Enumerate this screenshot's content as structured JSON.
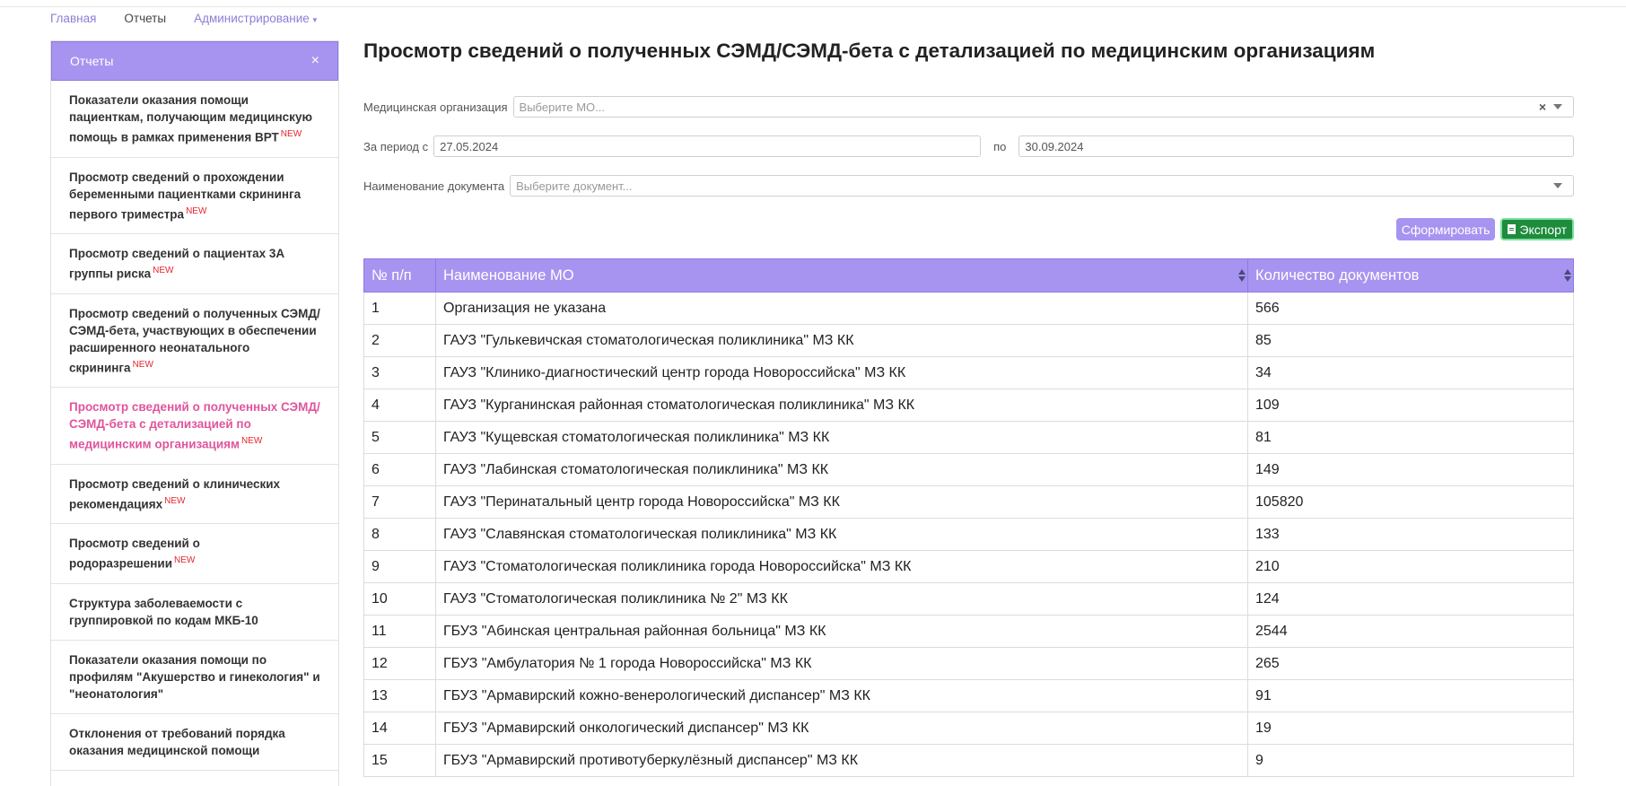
{
  "topnav": {
    "home": "Главная",
    "reports": "Отчеты",
    "admin": "Администрирование",
    "admin_caret": "▾"
  },
  "sidebar": {
    "title": "Отчеты",
    "close": "×",
    "new_badge": "NEW",
    "items": [
      {
        "label": "Показатели оказания помощи пациенткам, получающим медицинскую помощь в рамках применения ВРТ",
        "new": true
      },
      {
        "label": "Просмотр сведений о прохождении беременными пациентками скрининга первого триместра",
        "new": true
      },
      {
        "label": "Просмотр сведений о пациентах 3А группы риска",
        "new": true
      },
      {
        "label": "Просмотр сведений о полученных СЭМД/СЭМД-бета, участвующих в обеспечении расширенного неонатального скрининга",
        "new": true
      },
      {
        "label": "Просмотр сведений о полученных СЭМД/СЭМД-бета с детализацией по медицинским организациям",
        "new": true,
        "active": true
      },
      {
        "label": "Просмотр сведений о клинических рекомендациях",
        "new": true
      },
      {
        "label": "Просмотр сведений о родоразрешении",
        "new": true
      },
      {
        "label": "Структура заболеваемости с группировкой по кодам МКБ-10",
        "new": false
      },
      {
        "label": "Показатели оказания помощи по профилям \"Акушерство и гинекология\" и \"неонатология\"",
        "new": false
      },
      {
        "label": "Отклонения от требований порядка оказания медицинской помощи",
        "new": false
      }
    ]
  },
  "main": {
    "title": "Просмотр сведений о полученных СЭМД/СЭМД-бета с детализацией по медицинским организациям",
    "mo_label": "Медицинская организация",
    "mo_placeholder": "Выберите МО...",
    "mo_clear": "×",
    "period_label": "За период с",
    "period_from": "27.05.2024",
    "period_to_label": "по",
    "period_to": "30.09.2024",
    "doc_label": "Наименование документа",
    "doc_placeholder": "Выберите документ...",
    "generate_label": "Сформировать",
    "export_label": "Экспорт"
  },
  "table": {
    "headers": [
      "№ п/п",
      "Наименование МО",
      "Количество документов"
    ],
    "rows": [
      [
        "1",
        "Организация не указана",
        "566"
      ],
      [
        "2",
        "ГАУЗ \"Гулькевичская стоматологическая поликлиника\" МЗ КК",
        "85"
      ],
      [
        "3",
        "ГАУЗ \"Клинико-диагностический центр города Новороссийска\" МЗ КК",
        "34"
      ],
      [
        "4",
        "ГАУЗ \"Курганинская районная стоматологическая поликлиника\" МЗ КК",
        "109"
      ],
      [
        "5",
        "ГАУЗ \"Кущевская стоматологическая поликлиника\" МЗ КК",
        "81"
      ],
      [
        "6",
        "ГАУЗ \"Лабинская стоматологическая поликлиника\" МЗ КК",
        "149"
      ],
      [
        "7",
        "ГАУЗ \"Перинатальный центр города Новороссийска\" МЗ КК",
        "105820"
      ],
      [
        "8",
        "ГАУЗ \"Славянская стоматологическая поликлиника\" МЗ КК",
        "133"
      ],
      [
        "9",
        "ГАУЗ \"Стоматологическая поликлиника города Новороссийска\" МЗ КК",
        "210"
      ],
      [
        "10",
        "ГАУЗ \"Стоматологическая поликлиника № 2\" МЗ КК",
        "124"
      ],
      [
        "11",
        "ГБУЗ \"Абинская центральная районная больница\" МЗ КК",
        "2544"
      ],
      [
        "12",
        "ГБУЗ \"Амбулатория № 1 города Новороссийска\" МЗ КК",
        "265"
      ],
      [
        "13",
        "ГБУЗ \"Армавирский кожно-венерологический диспансер\" МЗ КК",
        "91"
      ],
      [
        "14",
        "ГБУЗ \"Армавирский онкологический диспансер\" МЗ КК",
        "19"
      ],
      [
        "15",
        "ГБУЗ \"Армавирский противотуберкулёзный диспансер\" МЗ КК",
        "9"
      ]
    ]
  }
}
